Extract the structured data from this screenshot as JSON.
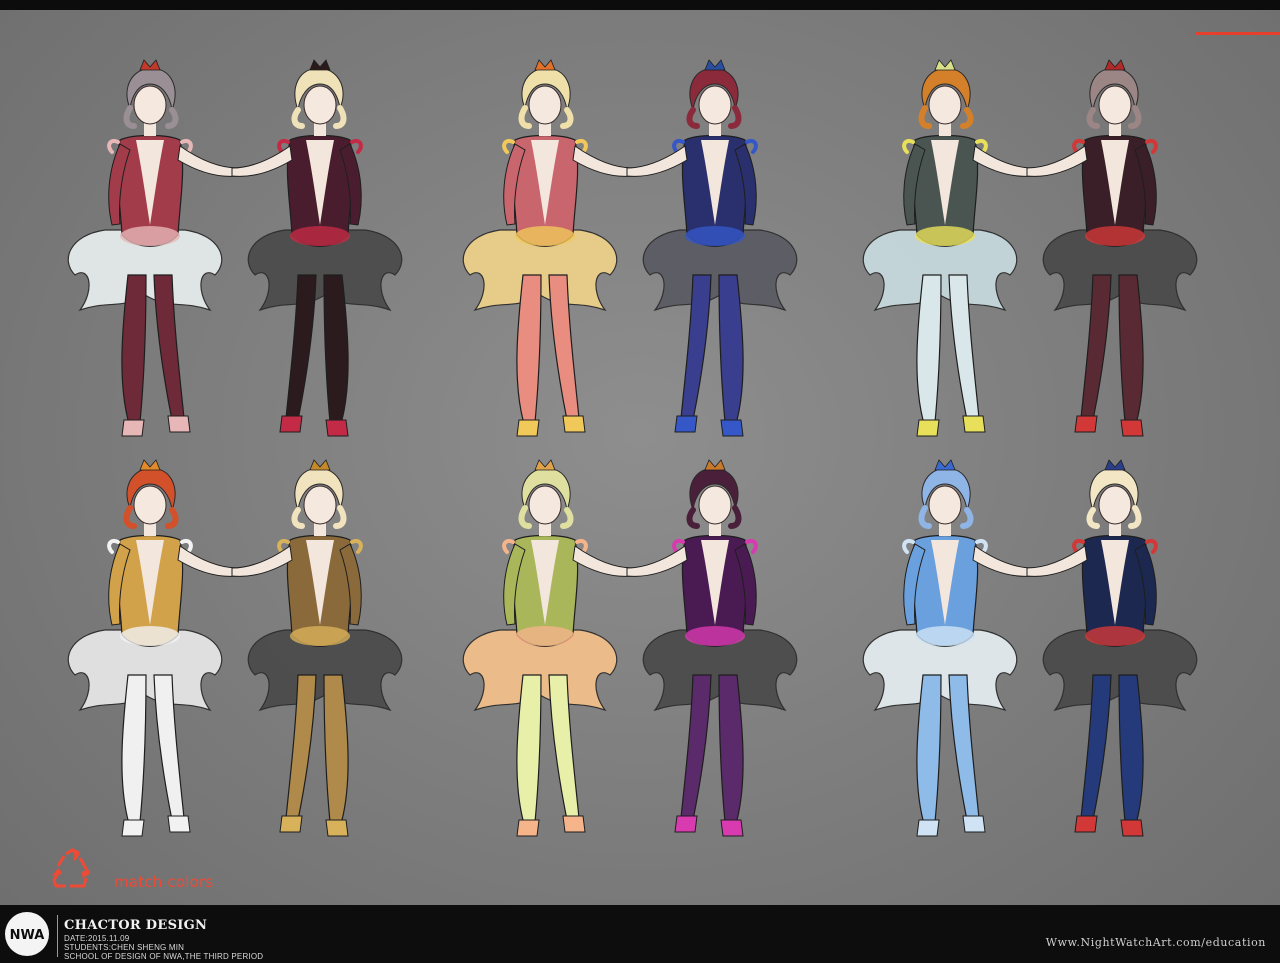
{
  "match_label": "match colors",
  "logo_text": "NWA",
  "footer": {
    "title": "CHACTOR DESIGN",
    "date": "DATE:2015.11.09",
    "students": "STUDENTS:CHEN SHENG MIN",
    "school": "SCHOOL OF DESIGN OF NWA,THE THIRD PERIOD",
    "url": "Www.NightWatchArt.com/education"
  },
  "colors": {
    "accent": "#e4402c",
    "label": "#ee4a36",
    "background": "#808080",
    "footer": "#0d0d0d"
  },
  "icons": [
    "recycle-icon",
    "nwa-logo-icon"
  ],
  "pairs": [
    {
      "left": {
        "hair": "#9a8f95",
        "crown": "#c0392b",
        "dress": "#a23c4a",
        "accent": "#e7b7b7",
        "legs": "#6e2a38",
        "skirt": "#e8eeee"
      },
      "right": {
        "hair": "#efe1b8",
        "crown": "#2a1a1a",
        "dress": "#4a1d2e",
        "accent": "#c22a45",
        "legs": "#2b1b1e",
        "skirt": "#4a4a4a"
      }
    },
    {
      "left": {
        "hair": "#efe0a9",
        "crown": "#e0702a",
        "dress": "#c9656d",
        "accent": "#f1c85a",
        "legs": "#e88d80",
        "skirt": "#f0d28a"
      },
      "right": {
        "hair": "#8a2a3a",
        "crown": "#2b4fa0",
        "dress": "#2a2f6d",
        "accent": "#3557c8",
        "legs": "#3a3e8e",
        "skirt": "#5a5a64"
      }
    },
    {
      "left": {
        "hair": "#d4802a",
        "crown": "#d8e08a",
        "dress": "#4a5552",
        "accent": "#e8e05a",
        "legs": "#d9e7ea",
        "skirt": "#c8dbe0"
      },
      "right": {
        "hair": "#9b8585",
        "crown": "#b02a2a",
        "dress": "#3a1f28",
        "accent": "#d23838",
        "legs": "#5a2a34",
        "skirt": "#4a4a4a"
      }
    },
    {
      "left": {
        "hair": "#d2502a",
        "crown": "#e08a2a",
        "dress": "#d2a24a",
        "accent": "#f2f2f2",
        "legs": "#f0f0f0",
        "skirt": "#e8e8e8"
      },
      "right": {
        "hair": "#f1e3bd",
        "crown": "#c48a2a",
        "dress": "#8a6a3a",
        "accent": "#d8b25a",
        "legs": "#b08a4a",
        "skirt": "#4a4a4a"
      }
    },
    {
      "left": {
        "hair": "#dfe0a0",
        "crown": "#e0a24a",
        "dress": "#a9b65a",
        "accent": "#f5b48a",
        "legs": "#e8efa8",
        "skirt": "#f4c08a"
      },
      "right": {
        "hair": "#4a1f3a",
        "crown": "#c87a2a",
        "dress": "#4a1a52",
        "accent": "#d83ab0",
        "legs": "#5a2a6a",
        "skirt": "#4a4a4a"
      }
    },
    {
      "left": {
        "hair": "#8fb4e6",
        "crown": "#3a6ad0",
        "dress": "#6aa0dd",
        "accent": "#cfe3f5",
        "legs": "#8fbbe8",
        "skirt": "#e6eef2"
      },
      "right": {
        "hair": "#f2e6c4",
        "crown": "#2a3e8a",
        "dress": "#1c2850",
        "accent": "#d23838",
        "legs": "#243a7a",
        "skirt": "#4a4a4a"
      }
    }
  ]
}
